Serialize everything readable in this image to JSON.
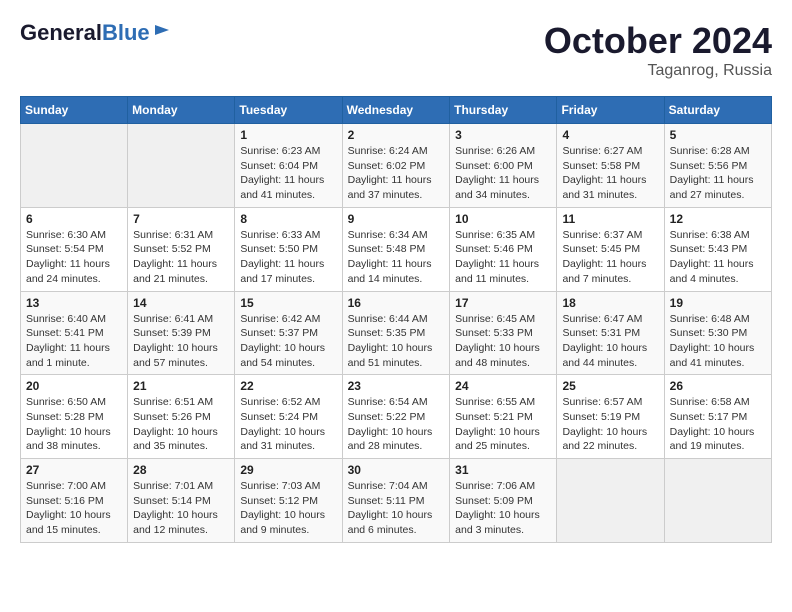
{
  "header": {
    "logo_general": "General",
    "logo_blue": "Blue",
    "title": "October 2024",
    "location": "Taganrog, Russia"
  },
  "weekdays": [
    "Sunday",
    "Monday",
    "Tuesday",
    "Wednesday",
    "Thursday",
    "Friday",
    "Saturday"
  ],
  "weeks": [
    [
      {
        "day": "",
        "content": ""
      },
      {
        "day": "",
        "content": ""
      },
      {
        "day": "1",
        "content": "Sunrise: 6:23 AM\nSunset: 6:04 PM\nDaylight: 11 hours and 41 minutes."
      },
      {
        "day": "2",
        "content": "Sunrise: 6:24 AM\nSunset: 6:02 PM\nDaylight: 11 hours and 37 minutes."
      },
      {
        "day": "3",
        "content": "Sunrise: 6:26 AM\nSunset: 6:00 PM\nDaylight: 11 hours and 34 minutes."
      },
      {
        "day": "4",
        "content": "Sunrise: 6:27 AM\nSunset: 5:58 PM\nDaylight: 11 hours and 31 minutes."
      },
      {
        "day": "5",
        "content": "Sunrise: 6:28 AM\nSunset: 5:56 PM\nDaylight: 11 hours and 27 minutes."
      }
    ],
    [
      {
        "day": "6",
        "content": "Sunrise: 6:30 AM\nSunset: 5:54 PM\nDaylight: 11 hours and 24 minutes."
      },
      {
        "day": "7",
        "content": "Sunrise: 6:31 AM\nSunset: 5:52 PM\nDaylight: 11 hours and 21 minutes."
      },
      {
        "day": "8",
        "content": "Sunrise: 6:33 AM\nSunset: 5:50 PM\nDaylight: 11 hours and 17 minutes."
      },
      {
        "day": "9",
        "content": "Sunrise: 6:34 AM\nSunset: 5:48 PM\nDaylight: 11 hours and 14 minutes."
      },
      {
        "day": "10",
        "content": "Sunrise: 6:35 AM\nSunset: 5:46 PM\nDaylight: 11 hours and 11 minutes."
      },
      {
        "day": "11",
        "content": "Sunrise: 6:37 AM\nSunset: 5:45 PM\nDaylight: 11 hours and 7 minutes."
      },
      {
        "day": "12",
        "content": "Sunrise: 6:38 AM\nSunset: 5:43 PM\nDaylight: 11 hours and 4 minutes."
      }
    ],
    [
      {
        "day": "13",
        "content": "Sunrise: 6:40 AM\nSunset: 5:41 PM\nDaylight: 11 hours and 1 minute."
      },
      {
        "day": "14",
        "content": "Sunrise: 6:41 AM\nSunset: 5:39 PM\nDaylight: 10 hours and 57 minutes."
      },
      {
        "day": "15",
        "content": "Sunrise: 6:42 AM\nSunset: 5:37 PM\nDaylight: 10 hours and 54 minutes."
      },
      {
        "day": "16",
        "content": "Sunrise: 6:44 AM\nSunset: 5:35 PM\nDaylight: 10 hours and 51 minutes."
      },
      {
        "day": "17",
        "content": "Sunrise: 6:45 AM\nSunset: 5:33 PM\nDaylight: 10 hours and 48 minutes."
      },
      {
        "day": "18",
        "content": "Sunrise: 6:47 AM\nSunset: 5:31 PM\nDaylight: 10 hours and 44 minutes."
      },
      {
        "day": "19",
        "content": "Sunrise: 6:48 AM\nSunset: 5:30 PM\nDaylight: 10 hours and 41 minutes."
      }
    ],
    [
      {
        "day": "20",
        "content": "Sunrise: 6:50 AM\nSunset: 5:28 PM\nDaylight: 10 hours and 38 minutes."
      },
      {
        "day": "21",
        "content": "Sunrise: 6:51 AM\nSunset: 5:26 PM\nDaylight: 10 hours and 35 minutes."
      },
      {
        "day": "22",
        "content": "Sunrise: 6:52 AM\nSunset: 5:24 PM\nDaylight: 10 hours and 31 minutes."
      },
      {
        "day": "23",
        "content": "Sunrise: 6:54 AM\nSunset: 5:22 PM\nDaylight: 10 hours and 28 minutes."
      },
      {
        "day": "24",
        "content": "Sunrise: 6:55 AM\nSunset: 5:21 PM\nDaylight: 10 hours and 25 minutes."
      },
      {
        "day": "25",
        "content": "Sunrise: 6:57 AM\nSunset: 5:19 PM\nDaylight: 10 hours and 22 minutes."
      },
      {
        "day": "26",
        "content": "Sunrise: 6:58 AM\nSunset: 5:17 PM\nDaylight: 10 hours and 19 minutes."
      }
    ],
    [
      {
        "day": "27",
        "content": "Sunrise: 7:00 AM\nSunset: 5:16 PM\nDaylight: 10 hours and 15 minutes."
      },
      {
        "day": "28",
        "content": "Sunrise: 7:01 AM\nSunset: 5:14 PM\nDaylight: 10 hours and 12 minutes."
      },
      {
        "day": "29",
        "content": "Sunrise: 7:03 AM\nSunset: 5:12 PM\nDaylight: 10 hours and 9 minutes."
      },
      {
        "day": "30",
        "content": "Sunrise: 7:04 AM\nSunset: 5:11 PM\nDaylight: 10 hours and 6 minutes."
      },
      {
        "day": "31",
        "content": "Sunrise: 7:06 AM\nSunset: 5:09 PM\nDaylight: 10 hours and 3 minutes."
      },
      {
        "day": "",
        "content": ""
      },
      {
        "day": "",
        "content": ""
      }
    ]
  ]
}
